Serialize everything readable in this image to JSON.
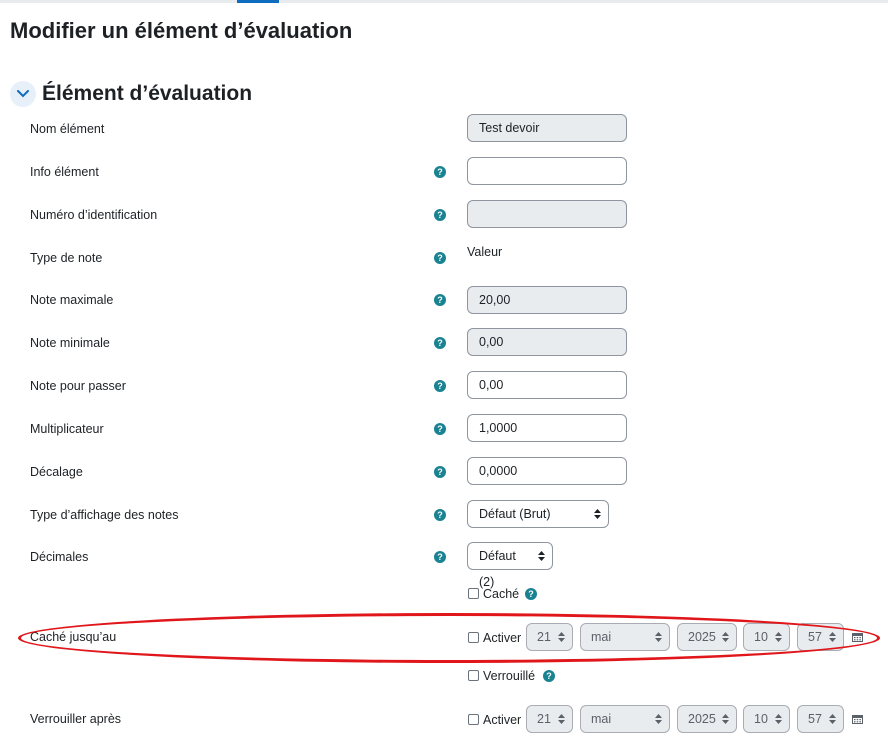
{
  "page": {
    "title": "Modifier un élément d’évaluation"
  },
  "section": {
    "title": "Élément d’évaluation"
  },
  "fields": {
    "nom": {
      "label": "Nom élément",
      "value": "Test devoir"
    },
    "info": {
      "label": "Info élément",
      "value": ""
    },
    "idnumber": {
      "label": "Numéro d’identification",
      "value": ""
    },
    "gradetype": {
      "label": "Type de note",
      "value": "Valeur"
    },
    "grademax": {
      "label": "Note maximale",
      "value": "20,00"
    },
    "grademin": {
      "label": "Note minimale",
      "value": "0,00"
    },
    "gradepass": {
      "label": "Note pour passer",
      "value": "0,00"
    },
    "multfactor": {
      "label": "Multiplicateur",
      "value": "1,0000"
    },
    "plusfactor": {
      "label": "Décalage",
      "value": "0,0000"
    },
    "display": {
      "label": "Type d’affichage des notes",
      "value": "Défaut (Brut)"
    },
    "decimals": {
      "label": "Décimales",
      "value": "Défaut (2)"
    }
  },
  "hidden": {
    "label": "Caché"
  },
  "hiddenuntil": {
    "label": "Caché jusqu’au",
    "enable_label": "Activer",
    "day": "21",
    "month": "mai",
    "year": "2025",
    "hour": "10",
    "minute": "57"
  },
  "locked": {
    "label": "Verrouillé"
  },
  "locktime": {
    "label": "Verrouiller après",
    "enable_label": "Activer",
    "day": "21",
    "month": "mai",
    "year": "2025",
    "hour": "10",
    "minute": "57"
  },
  "help_icon": "?",
  "icons": {
    "expand": "chevron-down-icon",
    "help": "question-circle-icon",
    "calendar": "calendar-icon"
  },
  "colors": {
    "accent": "#0f6cbf",
    "help": "#1a8391",
    "highlight": "#e0161b"
  }
}
